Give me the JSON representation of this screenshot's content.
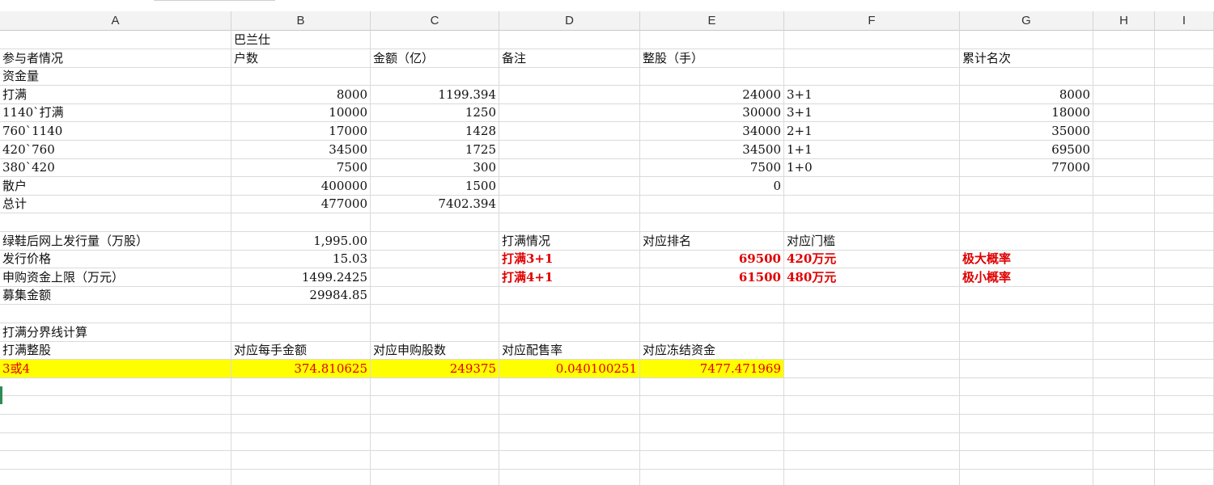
{
  "columns": [
    "A",
    "B",
    "C",
    "D",
    "E",
    "F",
    "G",
    "H",
    "I"
  ],
  "rows": [
    {
      "A": "",
      "B": "巴兰仕",
      "C": "",
      "D": "",
      "E": "",
      "F": "",
      "G": ""
    },
    {
      "A": "参与者情况",
      "B": "户数",
      "C": "金额（亿）",
      "D": "备注",
      "E": "整股（手）",
      "F": "",
      "G": "累计名次"
    },
    {
      "A": "资金量",
      "B": "",
      "C": "",
      "D": "",
      "E": "",
      "F": "",
      "G": ""
    },
    {
      "A": "打满",
      "B": "8000",
      "C": "1199.394",
      "D": "",
      "E": "24000",
      "F": "3+1",
      "G": "8000"
    },
    {
      "A": "1140`打满",
      "B": "10000",
      "C": "1250",
      "D": "",
      "E": "30000",
      "F": "3+1",
      "G": "18000"
    },
    {
      "A": "760`1140",
      "B": "17000",
      "C": "1428",
      "D": "",
      "E": "34000",
      "F": "2+1",
      "G": "35000"
    },
    {
      "A": "420`760",
      "B": "34500",
      "C": "1725",
      "D": "",
      "E": "34500",
      "F": "1+1",
      "G": "69500"
    },
    {
      "A": "380`420",
      "B": "7500",
      "C": "300",
      "D": "",
      "E": "7500",
      "F": "1+0",
      "G": "77000"
    },
    {
      "A": "散户",
      "B": "400000",
      "C": "1500",
      "D": "",
      "E": "0",
      "F": "",
      "G": ""
    },
    {
      "A": "总计",
      "B": "477000",
      "C": "7402.394",
      "D": "",
      "E": "",
      "F": "",
      "G": ""
    },
    {
      "A": "",
      "B": "",
      "C": "",
      "D": "",
      "E": "",
      "F": "",
      "G": ""
    },
    {
      "A": "绿鞋后网上发行量（万股）",
      "B": "1,995.00",
      "C": "",
      "D": "打满情况",
      "E": "对应排名",
      "F": "对应门槛",
      "G": ""
    },
    {
      "A": "发行价格",
      "B": "15.03",
      "C": "",
      "D": "打满3+1",
      "E": "69500",
      "F": "420万元",
      "G": "极大概率"
    },
    {
      "A": "申购资金上限（万元）",
      "B": "1499.2425",
      "C": "",
      "D": "打满4+1",
      "E": "61500",
      "F": "480万元",
      "G": "极小概率"
    },
    {
      "A": "募集金额",
      "B": "29984.85",
      "C": "",
      "D": "",
      "E": "",
      "F": "",
      "G": ""
    },
    {
      "A": "",
      "B": "",
      "C": "",
      "D": "",
      "E": "",
      "F": "",
      "G": ""
    },
    {
      "A": "打满分界线计算",
      "B": "",
      "C": "",
      "D": "",
      "E": "",
      "F": "",
      "G": ""
    },
    {
      "A": "打满整股",
      "B": "对应每手金额",
      "C": "对应申购股数",
      "D": "对应配售率",
      "E": "对应冻结资金",
      "F": "",
      "G": ""
    },
    {
      "A": "3或4",
      "B": "374.810625",
      "C": "249375",
      "D": "0.040100251",
      "E": "7477.471969",
      "F": "",
      "G": ""
    },
    {
      "A": "",
      "B": "",
      "C": "",
      "D": "",
      "E": "",
      "F": "",
      "G": ""
    },
    {
      "A": "",
      "B": "",
      "C": "",
      "D": "",
      "E": "",
      "F": "",
      "G": ""
    },
    {
      "A": "",
      "B": "",
      "C": "",
      "D": "",
      "E": "",
      "F": "",
      "G": ""
    },
    {
      "A": "",
      "B": "",
      "C": "",
      "D": "",
      "E": "",
      "F": "",
      "G": ""
    },
    {
      "A": "",
      "B": "",
      "C": "",
      "D": "",
      "E": "",
      "F": "",
      "G": ""
    },
    {
      "A": "",
      "B": "",
      "C": "",
      "D": "",
      "E": "",
      "F": "",
      "G": ""
    }
  ],
  "colors": {
    "highlight_fill": "#ffff00",
    "emphasis_text": "#e00000",
    "selection_marker": "#2e8b57"
  }
}
